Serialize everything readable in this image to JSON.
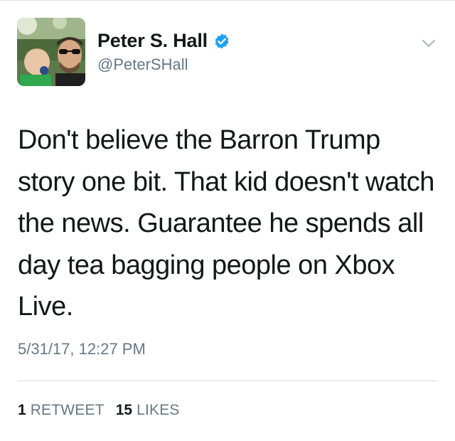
{
  "user": {
    "display_name": "Peter S. Hall",
    "handle": "@PeterSHall",
    "verified": true,
    "verified_color": "#1da1f2",
    "avatar_icon": "profile-photo"
  },
  "tweet": {
    "text": "Don't believe the Barron Trump story one bit. That kid doesn't watch the news. Guarantee he spends all day tea bagging people on Xbox Live.",
    "timestamp": "5/31/17, 12:27 PM"
  },
  "stats": {
    "retweets_count": "1",
    "retweets_label": "RETWEET",
    "likes_count": "15",
    "likes_label": "LIKES"
  },
  "colors": {
    "text_primary": "#14171a",
    "text_secondary": "#657786",
    "divider": "#d8dde2"
  },
  "icons": {
    "menu": "chevron-down-icon",
    "verified": "verified-badge-icon"
  }
}
